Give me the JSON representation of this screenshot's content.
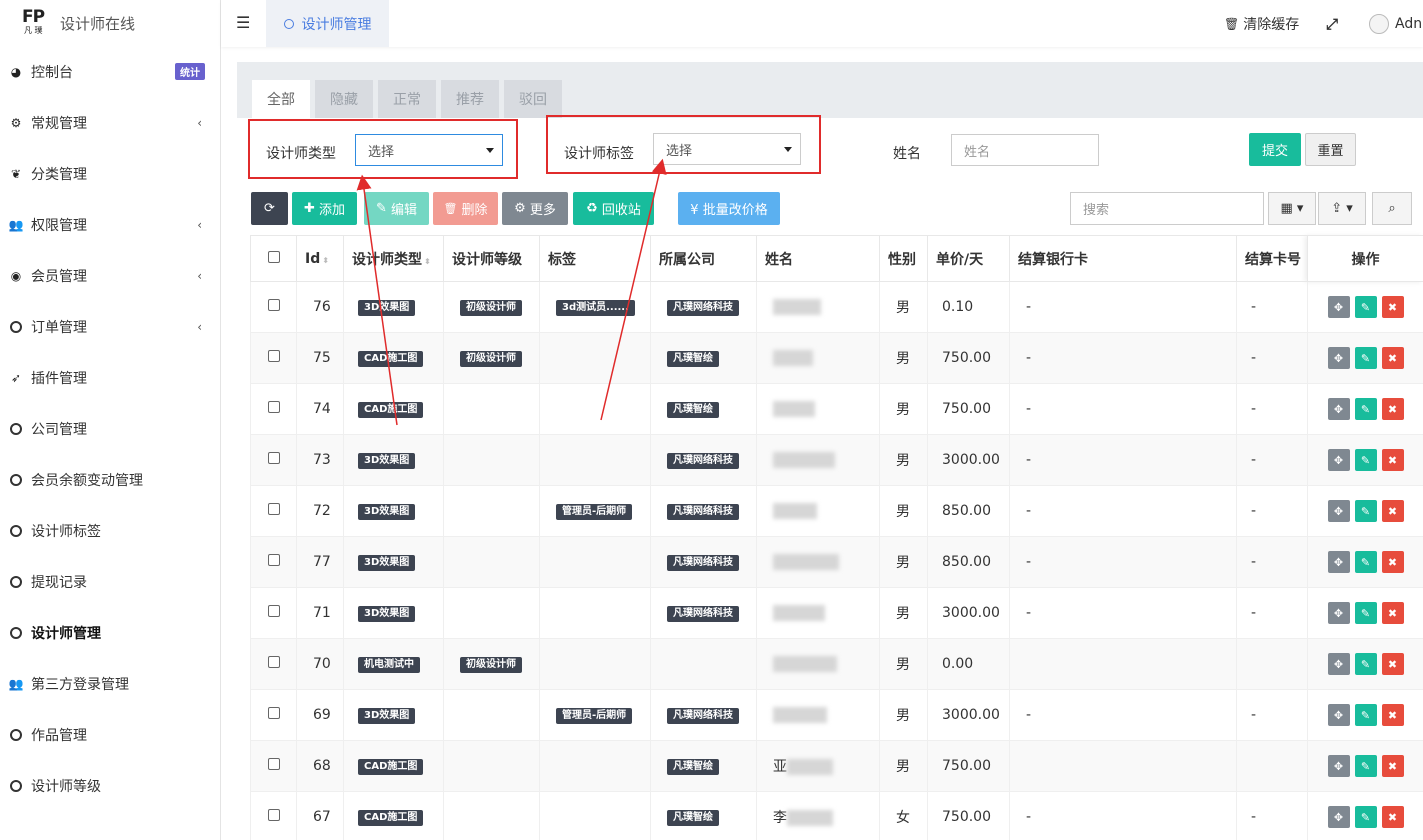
{
  "app": {
    "name": "设计师在线",
    "logo_text": "FP",
    "logo_sub": "凡 璞"
  },
  "sidebar": {
    "items": [
      {
        "label": "控制台",
        "icon": "dashboard-icon",
        "badge": "统计"
      },
      {
        "label": "常规管理",
        "icon": "cogs-icon",
        "chev": "‹"
      },
      {
        "label": "分类管理",
        "icon": "leaf-icon"
      },
      {
        "label": "权限管理",
        "icon": "group-icon",
        "chev": "‹"
      },
      {
        "label": "会员管理",
        "icon": "user-circle-icon",
        "chev": "‹"
      },
      {
        "label": "订单管理",
        "icon": "circle-icon",
        "chev": "‹"
      },
      {
        "label": "插件管理",
        "icon": "rocket-icon"
      },
      {
        "label": "公司管理",
        "icon": "circle-icon"
      },
      {
        "label": "会员余额变动管理",
        "icon": "circle-icon"
      },
      {
        "label": "设计师标签",
        "icon": "circle-icon"
      },
      {
        "label": "提现记录",
        "icon": "circle-icon"
      },
      {
        "label": "设计师管理",
        "icon": "circle-icon",
        "active": true
      },
      {
        "label": "第三方登录管理",
        "icon": "group-icon"
      },
      {
        "label": "作品管理",
        "icon": "circle-icon"
      },
      {
        "label": "设计师等级",
        "icon": "circle-icon"
      }
    ]
  },
  "topbar": {
    "tab": "设计师管理",
    "clear_cache": "清除缓存",
    "user": "Adn"
  },
  "filter_tabs": [
    "全部",
    "隐藏",
    "正常",
    "推荐",
    "驳回"
  ],
  "search_form": {
    "type_label": "设计师类型",
    "type_value": "选择",
    "tag_label": "设计师标签",
    "tag_value": "选择",
    "name_label": "姓名",
    "name_placeholder": "姓名",
    "submit": "提交",
    "reset": "重置"
  },
  "toolbar": {
    "add": "添加",
    "edit": "编辑",
    "delete": "删除",
    "more": "更多",
    "recycle": "回收站",
    "batch_price": "¥ 批量改价格",
    "search_placeholder": "搜索"
  },
  "table": {
    "headers": [
      "Id",
      "设计师类型",
      "设计师等级",
      "标签",
      "所属公司",
      "姓名",
      "性别",
      "单价/天",
      "结算银行卡",
      "结算卡号",
      "操作"
    ],
    "rows": [
      {
        "id": "76",
        "type": "3D效果图",
        "level": "初级设计师",
        "tag": "3d测试员......",
        "company": "凡璞网络科技",
        "name": "",
        "sex": "男",
        "price": "0.10",
        "bank": "-",
        "card": "-"
      },
      {
        "id": "75",
        "type": "CAD施工图",
        "level": "初级设计师",
        "tag": "",
        "company": "凡璞智绘",
        "name": "",
        "sex": "男",
        "price": "750.00",
        "bank": "-",
        "card": "-"
      },
      {
        "id": "74",
        "type": "CAD施工图",
        "level": "",
        "tag": "",
        "company": "凡璞智绘",
        "name": "",
        "sex": "男",
        "price": "750.00",
        "bank": "-",
        "card": "-"
      },
      {
        "id": "73",
        "type": "3D效果图",
        "level": "",
        "tag": "",
        "company": "凡璞网络科技",
        "name": "",
        "sex": "男",
        "price": "3000.00",
        "bank": "-",
        "card": "-"
      },
      {
        "id": "72",
        "type": "3D效果图",
        "level": "",
        "tag": "管理员-后期师",
        "company": "凡璞网络科技",
        "name": "",
        "sex": "男",
        "price": "850.00",
        "bank": "-",
        "card": "-"
      },
      {
        "id": "77",
        "type": "3D效果图",
        "level": "",
        "tag": "",
        "company": "凡璞网络科技",
        "name": "",
        "sex": "男",
        "price": "850.00",
        "bank": "-",
        "card": "-"
      },
      {
        "id": "71",
        "type": "3D效果图",
        "level": "",
        "tag": "",
        "company": "凡璞网络科技",
        "name": "",
        "sex": "男",
        "price": "3000.00",
        "bank": "-",
        "card": "-"
      },
      {
        "id": "70",
        "type": "机电测试中",
        "level": "初级设计师",
        "tag": "",
        "company": "",
        "name": "",
        "sex": "男",
        "price": "0.00",
        "bank": "",
        "card": ""
      },
      {
        "id": "69",
        "type": "3D效果图",
        "level": "",
        "tag": "管理员-后期师",
        "company": "凡璞网络科技",
        "name": "",
        "sex": "男",
        "price": "3000.00",
        "bank": "-",
        "card": "-"
      },
      {
        "id": "68",
        "type": "CAD施工图",
        "level": "",
        "tag": "",
        "company": "凡璞智绘",
        "name": "亚",
        "sex": "男",
        "price": "750.00",
        "bank": "",
        "card": ""
      },
      {
        "id": "67",
        "type": "CAD施工图",
        "level": "",
        "tag": "",
        "company": "凡璞智绘",
        "name": "李",
        "sex": "女",
        "price": "750.00",
        "bank": "-",
        "card": "-"
      }
    ]
  },
  "colors": {
    "primary": "#18bc9c",
    "danger": "#e74c3c",
    "dark": "#3d4451",
    "info": "#5bb0f0",
    "badge": "#6861ce",
    "annotation": "#e02b2b"
  }
}
